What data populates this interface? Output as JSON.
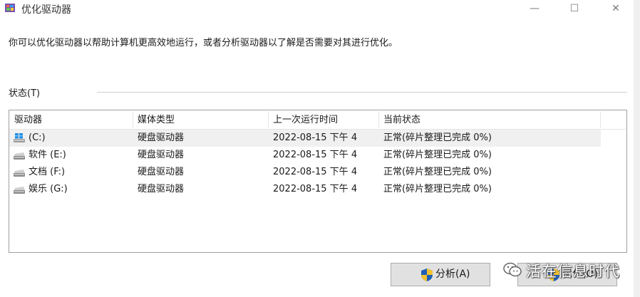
{
  "window": {
    "title": "优化驱动器",
    "controls": {
      "minimize": "—",
      "maximize": "☐",
      "close": "✕"
    }
  },
  "description": "你可以优化驱动器以帮助计算机更高效地运行，或者分析驱动器以了解是否需要对其进行优化。",
  "status_section": {
    "label": "状态(T)"
  },
  "table": {
    "columns": [
      "驱动器",
      "媒体类型",
      "上一次运行时间",
      "当前状态"
    ],
    "rows": [
      {
        "drive": "(C:)",
        "media": "硬盘驱动器",
        "last_run": "2022-08-15 下午 4",
        "status": "正常(碎片整理已完成 0%)",
        "icon": "windows-drive-icon",
        "selected": true
      },
      {
        "drive": "软件 (E:)",
        "media": "硬盘驱动器",
        "last_run": "2022-08-15 下午 4",
        "status": "正常(碎片整理已完成 0%)",
        "icon": "hard-drive-icon",
        "selected": false
      },
      {
        "drive": "文档 (F:)",
        "media": "硬盘驱动器",
        "last_run": "2022-08-15 下午 4",
        "status": "正常(碎片整理已完成 0%)",
        "icon": "hard-drive-icon",
        "selected": false
      },
      {
        "drive": "娱乐 (G:)",
        "media": "硬盘驱动器",
        "last_run": "2022-08-15 下午 4",
        "status": "正常(碎片整理已完成 0%)",
        "icon": "hard-drive-icon",
        "selected": false
      }
    ]
  },
  "buttons": {
    "analyze": "分析(A)",
    "optimize": "优化(O)"
  },
  "watermark": {
    "text": "活在信息时代",
    "icon": "wechat-icon"
  },
  "colors": {
    "button_bg": "#e1e1e1",
    "selected_row": "#f0f0f0",
    "shield_blue": "#1f5fb8",
    "shield_yellow": "#f2c230"
  }
}
